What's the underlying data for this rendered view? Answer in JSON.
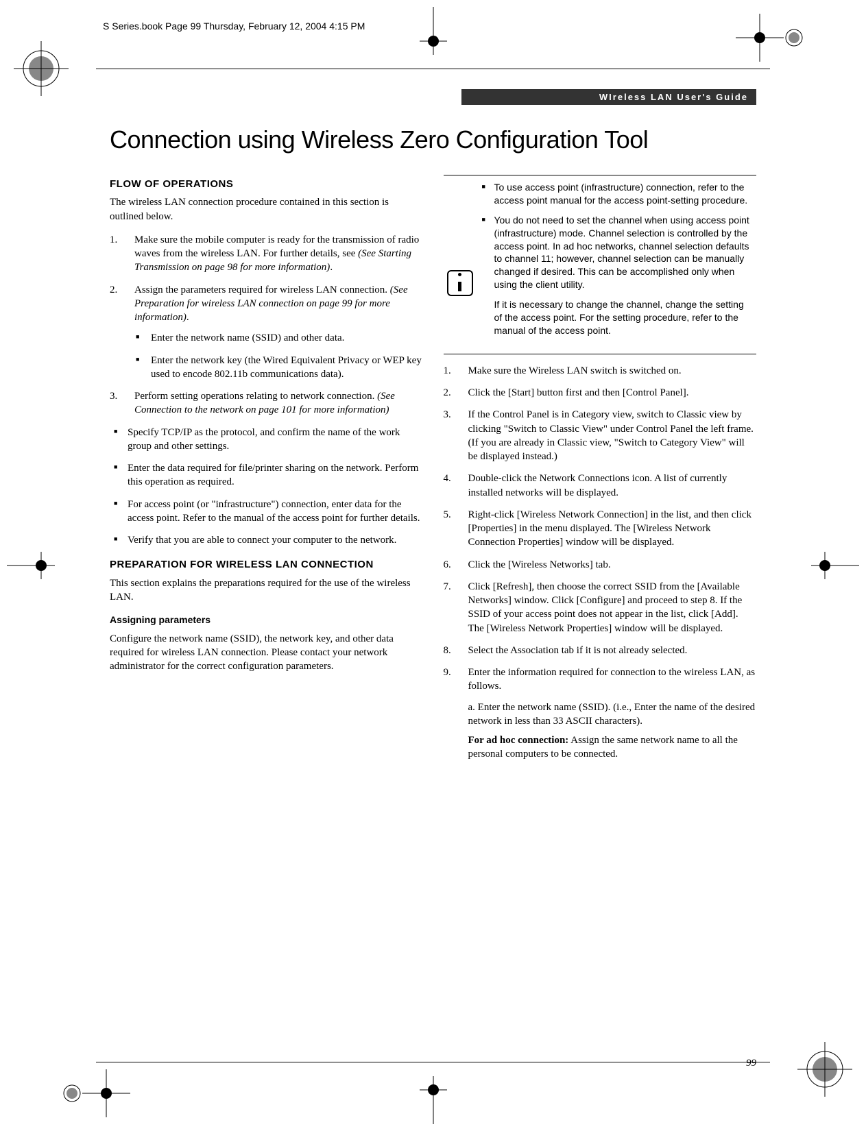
{
  "running_header": "S Series.book  Page 99  Thursday, February 12, 2004  4:15 PM",
  "guide_bar": "WIreless LAN User's Guide",
  "title": "Connection using Wireless Zero Configuration Tool",
  "left": {
    "flow_heading": "FLOW OF OPERATIONS",
    "flow_intro": "The wireless LAN connection procedure contained in this section is outlined below.",
    "step1_a": "Make sure the mobile computer is ready for the transmission of radio waves from the wireless LAN. For further details, see ",
    "step1_em": "(See Starting Transmission on page 98 for more information)",
    "step1_b": ".",
    "step2_a": "Assign the parameters required for wireless LAN connection. ",
    "step2_em": "(See Preparation for wireless LAN connection on page 99 for more information)",
    "step2_b": ".",
    "step2_sub1": "Enter the network name (SSID) and other data.",
    "step2_sub2": "Enter the network key (the Wired Equivalent Privacy or WEP key used to encode 802.11b communications data).",
    "step3_a": "Perform setting operations relating to network connection. ",
    "step3_em": "(See Connection to the network on page 101 for more information)",
    "bul1": "Specify TCP/IP as the protocol, and confirm the name of the work group and other settings.",
    "bul2": "Enter the data required for file/printer sharing on the network. Perform this operation as required.",
    "bul3": "For access point (or \"infrastructure\") connection, enter data for the access point. Refer to the manual of the access point for further details.",
    "bul4": "Verify that you are able to connect your computer to the network.",
    "prep_heading": "PREPARATION FOR WIRELESS LAN CONNECTION",
    "prep_intro": "This section explains the preparations required for the use of the wireless LAN.",
    "assign_heading": "Assigning parameters",
    "assign_body": "Configure the network name (SSID), the network key, and other data required for wireless LAN connection. Please contact your network administrator for the correct configuration parameters."
  },
  "right": {
    "callout_b1": "To use access point (infrastructure) connection, refer to the access point manual for the access point-setting procedure.",
    "callout_b2": "You do not need to set the channel when using access point (infrastructure) mode. Channel selection is controlled by the access point. In ad hoc networks, channel selection defaults to channel 11; however, channel selection can be manually changed if desired. This can be accomplished only when using the client utility.",
    "callout_p2": "If it is necessary to change the channel, change the setting of the access point. For the setting procedure, refer to the manual of the access point.",
    "s1": "Make sure the Wireless LAN switch is switched on.",
    "s2": "Click the [Start] button first and then [Control Panel].",
    "s3": "If the Control Panel is in Category view, switch to Classic view by clicking \"Switch to Classic View\" under Control Panel the left frame. (If you are already in Classic view, \"Switch to Category View\" will be displayed instead.)",
    "s4": "Double-click the Network Connections icon. A list of currently installed networks will be displayed.",
    "s5": "Right-click [Wireless Network Connection] in the list, and then click [Properties] in the menu displayed. The [Wireless Network Connection Properties] window will be displayed.",
    "s6": "Click the [Wireless Networks] tab.",
    "s7": "Click [Refresh], then choose the correct SSID from the [Available Networks] window. Click [Configure] and proceed to step 8. If the SSID of your access point does not appear in the list, click [Add]. The [Wireless Network Properties] window will be displayed.",
    "s8": "Select the Association tab if it is not already selected.",
    "s9": "Enter the information required for connection to the wireless LAN, as follows.",
    "s9a": "a. Enter the network name (SSID). (i.e., Enter the name of the desired network in less than 33 ASCII characters).",
    "s9a_bold": "For ad hoc connection:",
    "s9a_rest": " Assign the same network name to all the personal computers to be connected."
  },
  "page_number": "99"
}
